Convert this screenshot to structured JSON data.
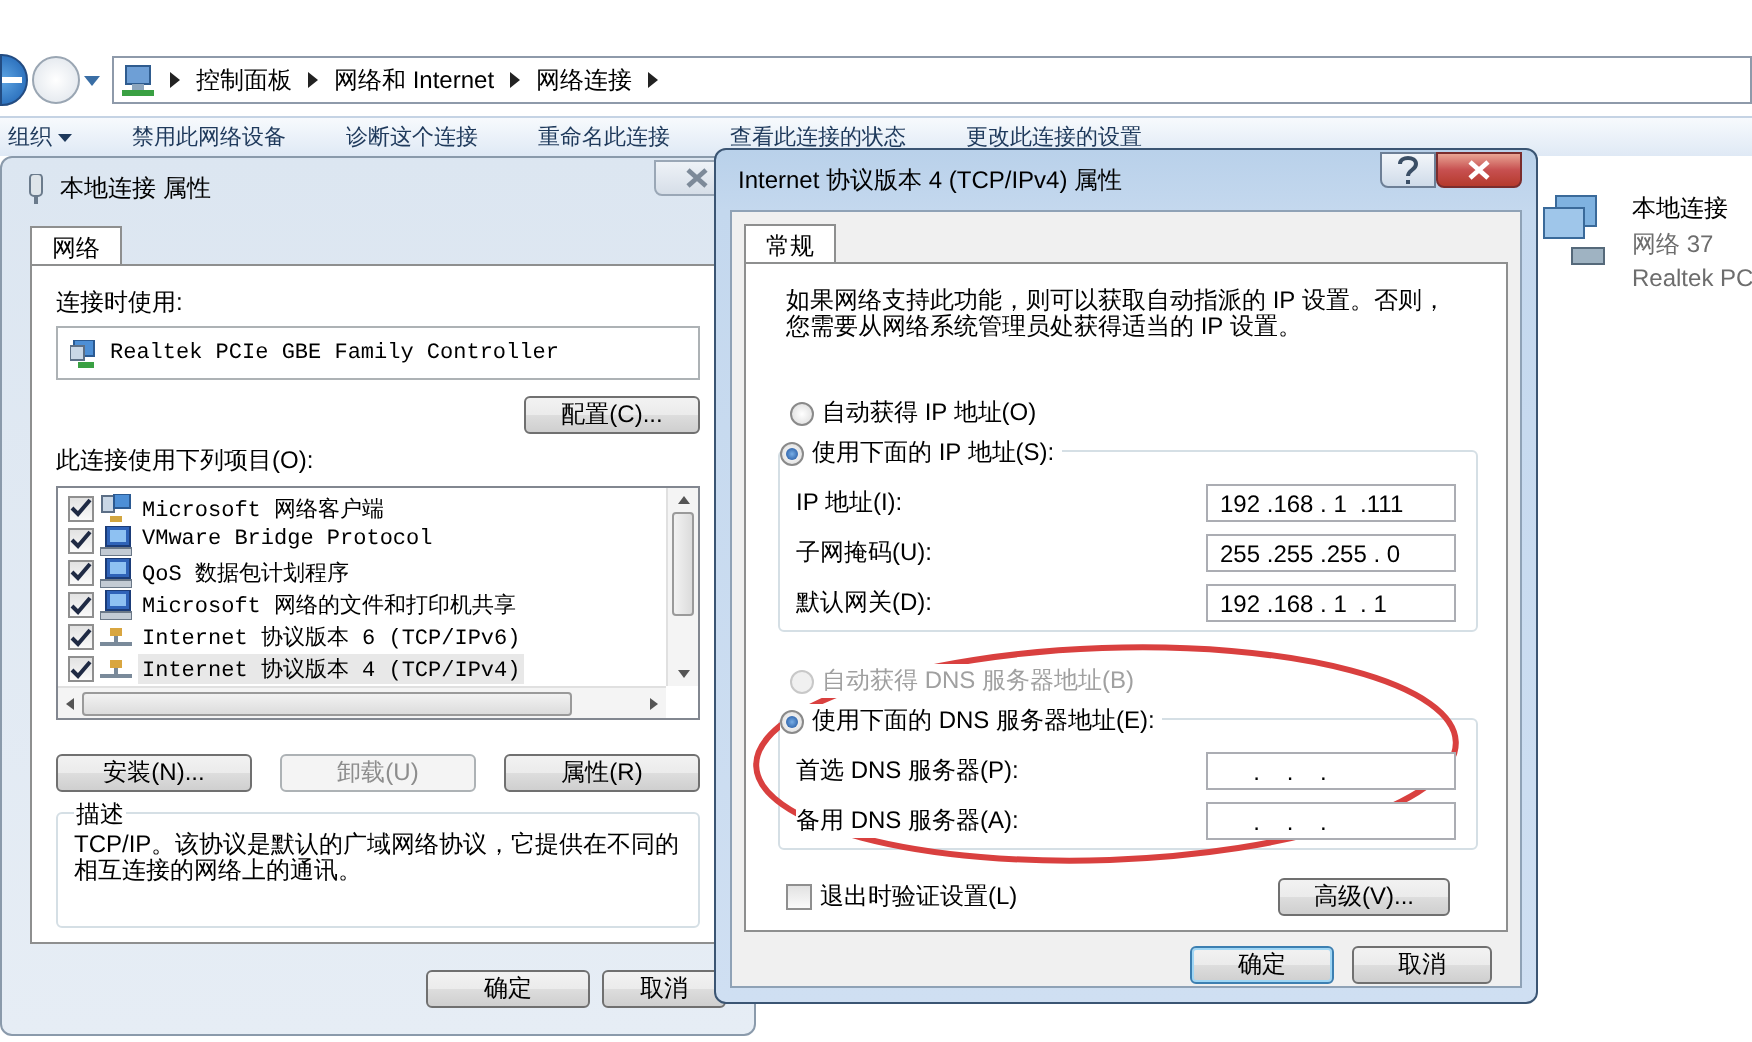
{
  "explorer": {
    "breadcrumbs": [
      "控制面板",
      "网络和 Internet",
      "网络连接"
    ],
    "toolbar": [
      {
        "label": "组织",
        "dropdown": true
      },
      {
        "label": "禁用此网络设备",
        "dropdown": false
      },
      {
        "label": "诊断这个连接",
        "dropdown": false
      },
      {
        "label": "重命名此连接",
        "dropdown": false
      },
      {
        "label": "查看此连接的状态",
        "dropdown": false
      },
      {
        "label": "更改此连接的设置",
        "dropdown": false
      }
    ],
    "connection": {
      "name": "本地连接",
      "network": "网络 37",
      "adapter": "Realtek PC"
    }
  },
  "properties_dialog": {
    "title": "本地连接 属性",
    "active": false,
    "tabs": [
      {
        "label": "网络",
        "selected": true
      }
    ],
    "connect_using_label": "连接时使用:",
    "adapter": "Realtek PCIe GBE Family Controller",
    "configure_button": "配置(C)...",
    "items_label": "此连接使用下列项目(O):",
    "items": [
      {
        "kind": "client",
        "label": "Microsoft 网络客户端",
        "checked": true,
        "selected": false
      },
      {
        "kind": "service",
        "label": "VMware Bridge Protocol",
        "checked": true,
        "selected": false
      },
      {
        "kind": "service",
        "label": "QoS 数据包计划程序",
        "checked": true,
        "selected": false
      },
      {
        "kind": "service",
        "label": "Microsoft 网络的文件和打印机共享",
        "checked": true,
        "selected": false
      },
      {
        "kind": "protocol",
        "label": "Internet 协议版本 6 (TCP/IPv6)",
        "checked": true,
        "selected": false
      },
      {
        "kind": "protocol",
        "label": "Internet 协议版本 4 (TCP/IPv4)",
        "checked": true,
        "selected": true
      }
    ],
    "buttons": [
      {
        "label": "安装(N)...",
        "disabled": false
      },
      {
        "label": "卸载(U)",
        "disabled": true
      },
      {
        "label": "属性(R)",
        "disabled": false
      }
    ],
    "description_title": "描述",
    "description": "TCP/IP。该协议是默认的广域网络协议，它提供在不同的相互连接的网络上的通讯。",
    "footer_buttons": [
      {
        "label": "确定",
        "default": false
      },
      {
        "label": "取消",
        "default": false
      }
    ]
  },
  "ipv4_dialog": {
    "title": "Internet 协议版本 4 (TCP/IPv4) 属性",
    "active": true,
    "tabs": [
      {
        "label": "常规",
        "selected": true
      }
    ],
    "intro": "如果网络支持此功能，则可以获取自动指派的 IP 设置。否则，您需要从网络系统管理员处获得适当的 IP 设置。",
    "ip_options": [
      {
        "label": "自动获得 IP 地址(O)",
        "selected": false,
        "disabled": false
      },
      {
        "label": "使用下面的 IP 地址(S):",
        "selected": true,
        "disabled": false
      }
    ],
    "ip_fields": [
      {
        "label": "IP 地址(I):",
        "value": "192 .168 . 1  .111"
      },
      {
        "label": "子网掩码(U):",
        "value": "255 .255 .255 . 0"
      },
      {
        "label": "默认网关(D):",
        "value": "192 .168 . 1  . 1"
      }
    ],
    "dns_options": [
      {
        "label": "自动获得 DNS 服务器地址(B)",
        "selected": false,
        "disabled": true
      },
      {
        "label": "使用下面的 DNS 服务器地址(E):",
        "selected": true,
        "disabled": false
      }
    ],
    "dns_fields": [
      {
        "label": "首选 DNS 服务器(P):",
        "value": "     .    .    ."
      },
      {
        "label": "备用 DNS 服务器(A):",
        "value": "     .    .    ."
      }
    ],
    "verify_checkbox": {
      "label": "退出时验证设置(L)",
      "checked": false
    },
    "advanced_button": "高级(V)...",
    "footer_buttons": [
      {
        "label": "确定",
        "default": true
      },
      {
        "label": "取消",
        "default": false
      }
    ]
  }
}
